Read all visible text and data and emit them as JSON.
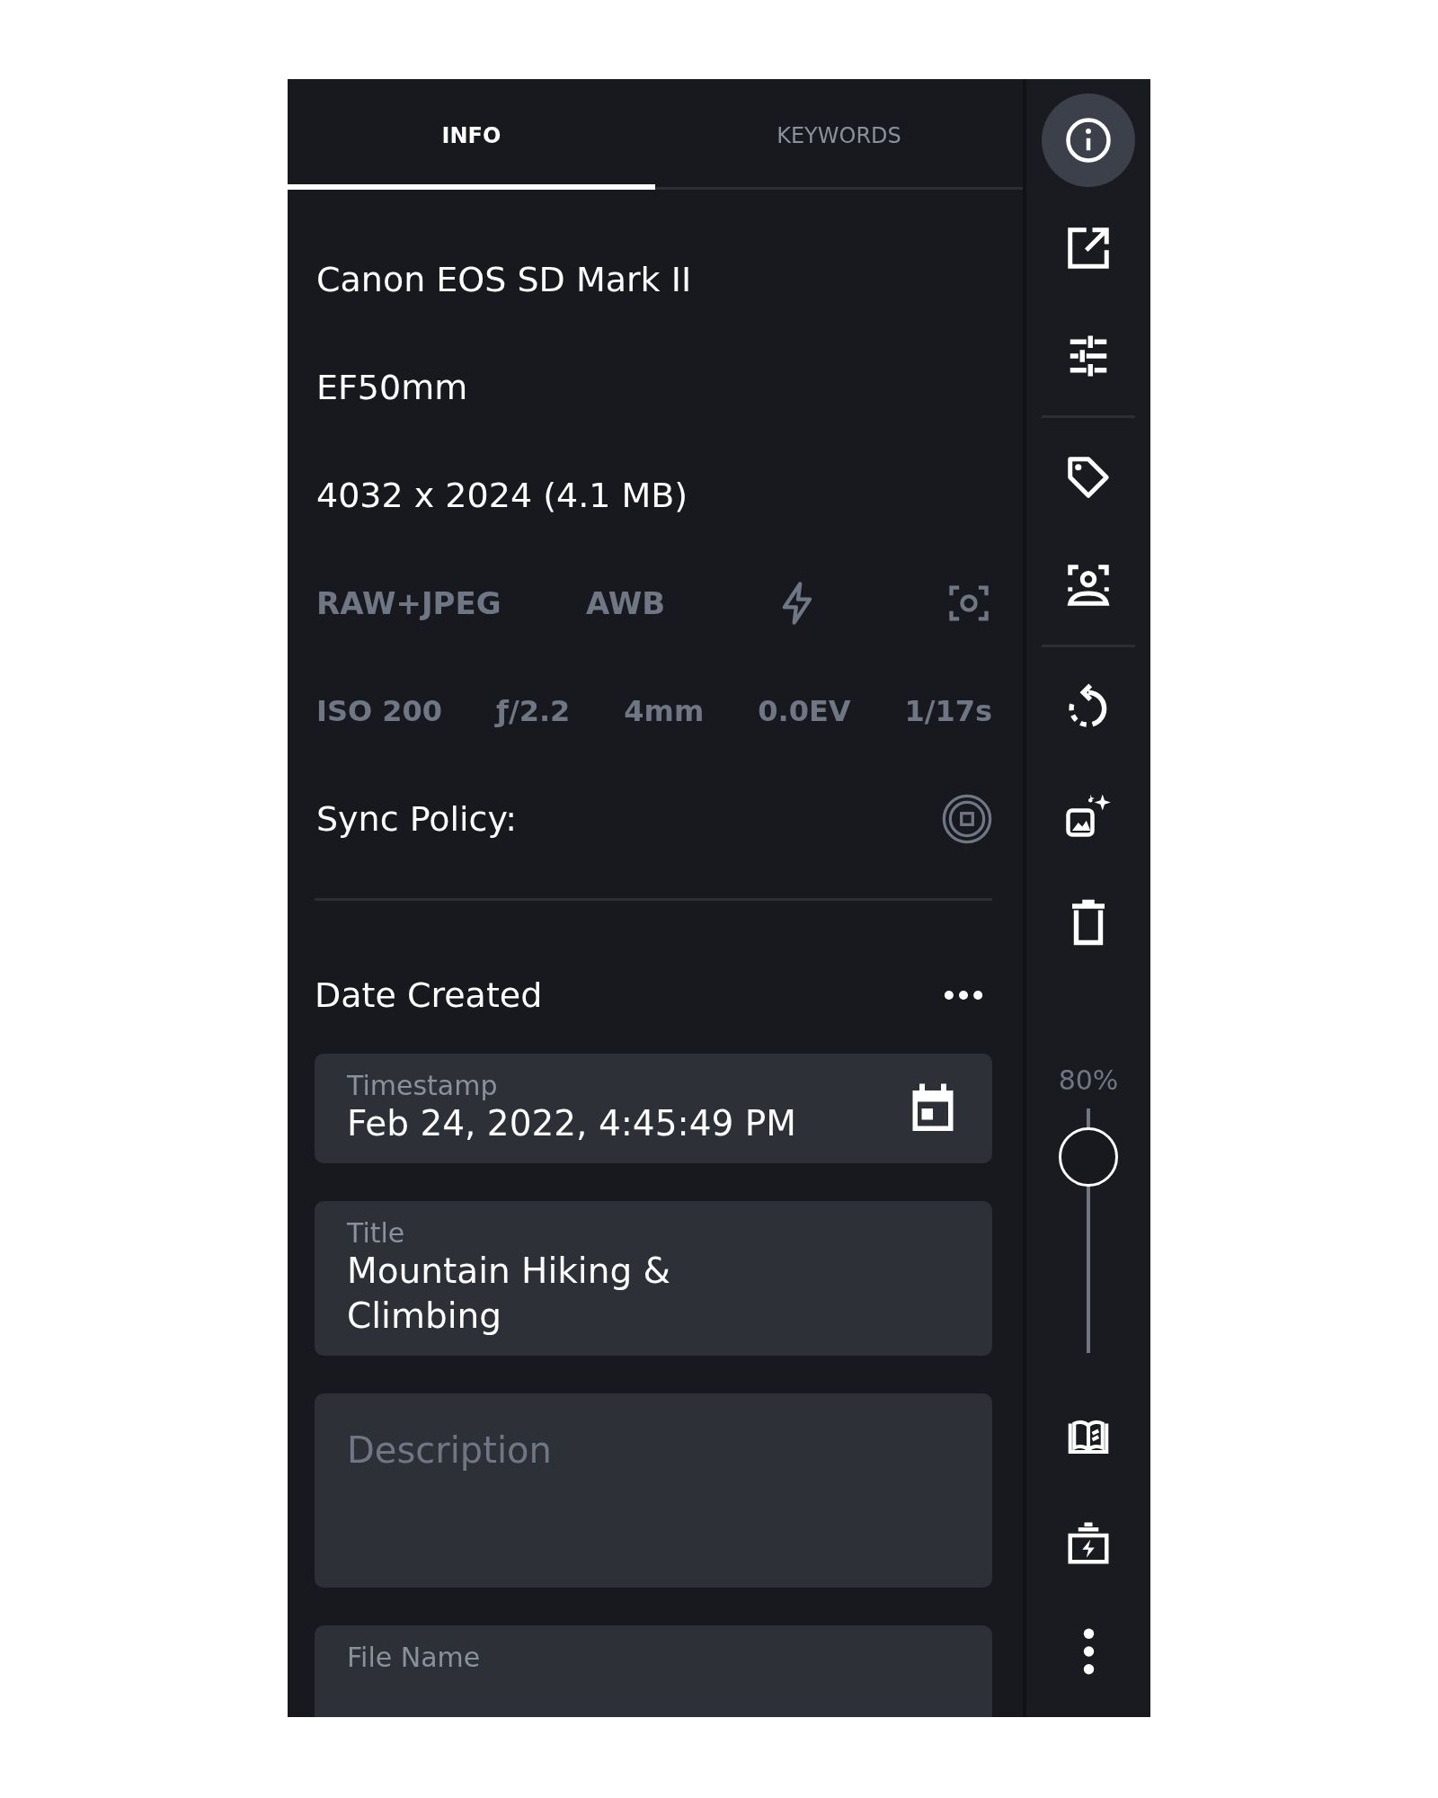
{
  "tabs": [
    {
      "label": "INFO",
      "selected": true
    },
    {
      "label": "KEYWORDS",
      "selected": false
    }
  ],
  "details": [
    "Canon EOS SD Mark II",
    "EF50mm",
    "4032 x 2024 (4.1 MB)"
  ],
  "capture": [
    "RAW+JPEG",
    "AWB"
  ],
  "exposure": [
    "ISO 200",
    "ƒ/2.2",
    "4mm",
    "0.0EV",
    "1/17s"
  ],
  "sync_policy": {
    "label": "Sync Policy:"
  },
  "date_section": {
    "title": "Date Created"
  },
  "fields": [
    {
      "kind": "date",
      "label": "Timestamp",
      "value": "Feb 24, 2022, 4:45:49 PM"
    },
    {
      "kind": "text",
      "label": "Title",
      "value": "Mountain Hiking & Climbing"
    },
    {
      "kind": "textarea",
      "placeholder": "Description"
    },
    {
      "kind": "text",
      "label": "File Name"
    }
  ],
  "rail": {
    "buttons": [
      {
        "selected": true
      },
      {
        "selected": false
      },
      {
        "selected": false
      },
      {
        "selected": false
      },
      {
        "selected": false
      },
      {
        "selected": false
      },
      {
        "selected": false
      },
      {
        "selected": false
      }
    ],
    "zoom": {
      "reading": "80%",
      "level": 0.8
    }
  }
}
